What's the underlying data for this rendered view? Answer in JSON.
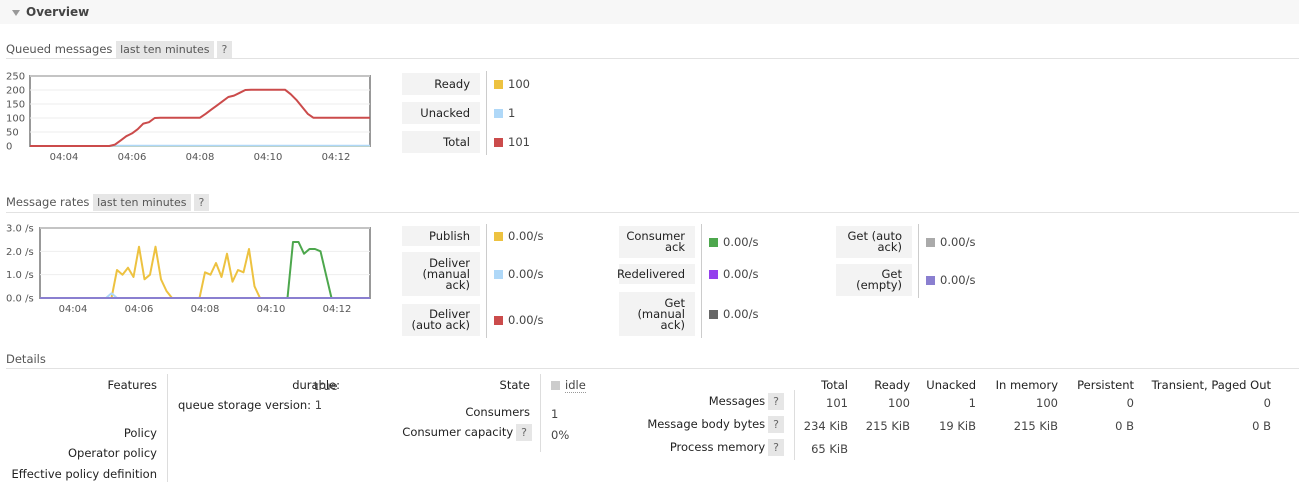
{
  "overview": {
    "title": "Overview"
  },
  "queued": {
    "title": "Queued messages",
    "range": "last ten minutes",
    "help": "?",
    "chart_data": {
      "type": "line",
      "x_ticks": [
        "04:04",
        "04:06",
        "04:08",
        "04:10",
        "04:12"
      ],
      "y_ticks": [
        "250",
        "200",
        "150",
        "100",
        "50",
        "0"
      ],
      "ylim": [
        0,
        250
      ],
      "x": [
        0,
        1,
        2,
        3,
        4,
        5,
        6,
        7,
        8,
        9,
        10,
        11,
        12,
        13,
        14,
        15,
        16,
        17,
        18,
        19,
        20,
        21,
        22,
        23,
        24,
        25,
        26,
        27,
        28,
        29,
        30,
        31,
        32,
        33,
        34,
        35,
        36,
        37,
        38,
        39,
        40,
        41,
        42,
        43,
        44,
        45,
        46,
        47,
        48,
        49,
        50,
        51,
        52,
        53,
        54,
        55,
        56,
        57,
        58,
        59,
        60
      ],
      "series": [
        {
          "name": "Ready",
          "color": "#edc240",
          "values": [
            0,
            0,
            0,
            0,
            0,
            0,
            0,
            0,
            0,
            0,
            0,
            0,
            0,
            0,
            0,
            0,
            0,
            0,
            0,
            0,
            0,
            0,
            0,
            0,
            0,
            0,
            0,
            0,
            0,
            0,
            0,
            0,
            0,
            0,
            0,
            0,
            0,
            0,
            0,
            0,
            0,
            0,
            0,
            0,
            0,
            0,
            0,
            0,
            0,
            0,
            0,
            0,
            0,
            0,
            0,
            0,
            0,
            0,
            0,
            0,
            0
          ]
        },
        {
          "name": "Unacked",
          "color": "#afd8f8",
          "values": [
            0,
            0,
            0,
            0,
            0,
            0,
            0,
            0,
            0,
            0,
            0,
            0,
            0,
            0,
            0,
            1,
            1,
            1,
            1,
            1,
            1,
            1,
            1,
            1,
            1,
            1,
            1,
            1,
            1,
            1,
            1,
            1,
            1,
            1,
            1,
            1,
            1,
            1,
            1,
            1,
            1,
            1,
            1,
            1,
            1,
            1,
            1,
            1,
            1,
            1,
            1,
            1,
            1,
            1,
            1,
            1,
            1,
            1,
            1,
            1,
            1
          ]
        },
        {
          "name": "Total",
          "color": "#cb4b4b",
          "values": [
            0,
            0,
            0,
            0,
            0,
            0,
            0,
            0,
            0,
            0,
            0,
            0,
            0,
            0,
            0,
            5,
            20,
            35,
            45,
            60,
            80,
            85,
            100,
            101,
            101,
            101,
            101,
            101,
            101,
            101,
            101,
            115,
            130,
            145,
            160,
            175,
            180,
            190,
            200,
            201,
            201,
            201,
            201,
            201,
            201,
            201,
            185,
            165,
            140,
            115,
            101,
            101,
            101,
            101,
            101,
            101,
            101,
            101,
            101,
            101,
            101
          ]
        }
      ]
    },
    "legend": [
      {
        "label": "Ready",
        "color": "#edc240",
        "value": "100"
      },
      {
        "label": "Unacked",
        "color": "#afd8f8",
        "value": "1"
      },
      {
        "label": "Total",
        "color": "#cb4b4b",
        "value": "101"
      }
    ]
  },
  "rates": {
    "title": "Message rates",
    "range": "last ten minutes",
    "help": "?",
    "chart_data": {
      "type": "line",
      "x_ticks": [
        "04:04",
        "04:06",
        "04:08",
        "04:10",
        "04:12"
      ],
      "y_ticks": [
        "3.0 /s",
        "2.0 /s",
        "1.0 /s",
        "0.0 /s"
      ],
      "ylim": [
        0,
        3
      ],
      "x": [
        0,
        1,
        2,
        3,
        4,
        5,
        6,
        7,
        8,
        9,
        10,
        11,
        12,
        13,
        14,
        15,
        16,
        17,
        18,
        19,
        20,
        21,
        22,
        23,
        24,
        25,
        26,
        27,
        28,
        29,
        30,
        31,
        32,
        33,
        34,
        35,
        36,
        37,
        38,
        39,
        40,
        41,
        42,
        43,
        44,
        45,
        46,
        47,
        48,
        49,
        50,
        51,
        52,
        53,
        54,
        55,
        56,
        57,
        58,
        59,
        60
      ],
      "series": [
        {
          "name": "Publish",
          "color": "#edc240",
          "values": [
            0,
            0,
            0,
            0,
            0,
            0,
            0,
            0,
            0,
            0,
            0,
            0,
            0,
            0,
            1.2,
            1.0,
            1.3,
            0.9,
            2.2,
            0.8,
            1.0,
            2.2,
            0.8,
            0.3,
            0,
            0,
            0,
            0,
            0,
            0,
            1.1,
            1.0,
            1.5,
            0.9,
            1.9,
            0.7,
            1.2,
            1.1,
            2.1,
            0.5,
            0,
            0,
            0,
            0,
            0,
            0,
            0,
            0,
            0,
            0,
            0,
            0,
            0,
            0,
            0,
            0,
            0,
            0,
            0,
            0,
            0
          ]
        },
        {
          "name": "Deliver (manual ack)",
          "color": "#afd8f8",
          "values": [
            0,
            0,
            0,
            0,
            0,
            0,
            0,
            0,
            0,
            0,
            0,
            0,
            0,
            0.2,
            0,
            0,
            0,
            0,
            0,
            0,
            0,
            0,
            0,
            0,
            0,
            0,
            0,
            0,
            0,
            0,
            0,
            0,
            0,
            0,
            0,
            0,
            0,
            0,
            0,
            0,
            0,
            0,
            0,
            0,
            0,
            0,
            0,
            0,
            0,
            0,
            0,
            0,
            0,
            0,
            0,
            0,
            0,
            0,
            0,
            0,
            0
          ]
        },
        {
          "name": "Consumer ack",
          "color": "#4da74d",
          "values": [
            0,
            0,
            0,
            0,
            0,
            0,
            0,
            0,
            0,
            0,
            0,
            0,
            0,
            0,
            0,
            0,
            0,
            0,
            0,
            0,
            0,
            0,
            0,
            0,
            0,
            0,
            0,
            0,
            0,
            0,
            0,
            0,
            0,
            0,
            0,
            0,
            0,
            0,
            0,
            0,
            0,
            0,
            0,
            0,
            0,
            0,
            2.4,
            2.4,
            1.9,
            2.1,
            2.1,
            2.0,
            1.0,
            0,
            0,
            0,
            0,
            0,
            0,
            0,
            0
          ]
        },
        {
          "name": "Get (empty)",
          "color": "#8a7fd0",
          "values": [
            0,
            0,
            0,
            0,
            0,
            0,
            0,
            0,
            0,
            0,
            0,
            0,
            0,
            0,
            0,
            0,
            0,
            0,
            0,
            0,
            0,
            0,
            0,
            0,
            0,
            0,
            0,
            0,
            0,
            0,
            0,
            0,
            0,
            0,
            0,
            0,
            0,
            0,
            0,
            0,
            0,
            0,
            0,
            0,
            0,
            0,
            0,
            0,
            0,
            0,
            0,
            0,
            0,
            0,
            0,
            0,
            0,
            0,
            0,
            0,
            0
          ]
        }
      ]
    },
    "legend_col1": [
      {
        "label": "Publish",
        "color": "#edc240",
        "value": "0.00/s"
      },
      {
        "label": "Deliver\n(manual\nack)",
        "color": "#afd8f8",
        "value": "0.00/s"
      },
      {
        "label": "Deliver\n(auto ack)",
        "color": "#cb4b4b",
        "value": "0.00/s"
      }
    ],
    "legend_col2": [
      {
        "label": "Consumer\nack",
        "color": "#4da74d",
        "value": "0.00/s"
      },
      {
        "label": "Redelivered",
        "color": "#9440ed",
        "value": "0.00/s"
      },
      {
        "label": "Get\n(manual\nack)",
        "color": "#666666",
        "value": "0.00/s"
      }
    ],
    "legend_col3": [
      {
        "label": "Get (auto\nack)",
        "color": "#aaaaaa",
        "value": "0.00/s"
      },
      {
        "label": "Get\n(empty)",
        "color": "#8a7fd0",
        "value": "0.00/s"
      }
    ]
  },
  "details": {
    "title": "Details",
    "features_label": "Features",
    "durable_key": "durable:",
    "durable_val": "true",
    "qsv_key": "queue storage version:",
    "qsv_val": "1",
    "policy_label": "Policy",
    "operator_policy_label": "Operator policy",
    "effective_policy_label": "Effective policy definition",
    "state_label": "State",
    "state_val": "idle",
    "consumers_label": "Consumers",
    "consumers_val": "1",
    "capacity_label": "Consumer capacity",
    "capacity_val": "0%",
    "help": "?",
    "table": {
      "headers": [
        "Total",
        "Ready",
        "Unacked",
        "In memory",
        "Persistent",
        "Transient, Paged Out"
      ],
      "rows": [
        {
          "label": "Messages",
          "values": [
            "101",
            "100",
            "1",
            "100",
            "0",
            "0"
          ]
        },
        {
          "label": "Message body bytes",
          "values": [
            "234 KiB",
            "215 KiB",
            "19 KiB",
            "215 KiB",
            "0 B",
            "0 B"
          ]
        },
        {
          "label": "Process memory",
          "values": [
            "65 KiB"
          ]
        }
      ]
    }
  }
}
